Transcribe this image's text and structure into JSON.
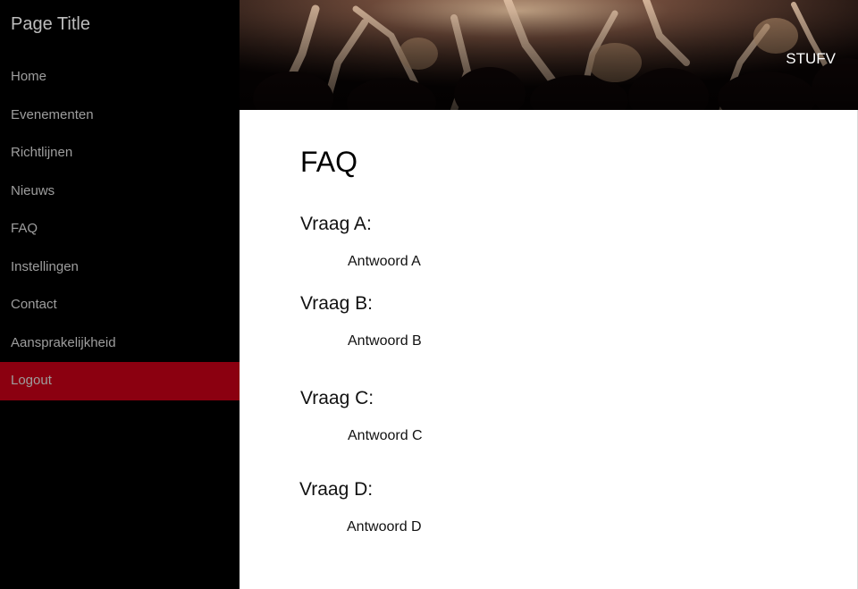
{
  "sidebar": {
    "title": "Page Title",
    "items": [
      {
        "label": "Home"
      },
      {
        "label": "Evenementen"
      },
      {
        "label": "Richtlijnen"
      },
      {
        "label": "Nieuws"
      },
      {
        "label": "FAQ"
      },
      {
        "label": "Instellingen"
      },
      {
        "label": "Contact"
      },
      {
        "label": "Aansprakelijkheid"
      },
      {
        "label": "Logout"
      }
    ],
    "active_item": "Logout",
    "active_color": "#8b0010"
  },
  "header": {
    "brand": "STUFV"
  },
  "main": {
    "heading": "FAQ",
    "faq": [
      {
        "question": "Vraag A:",
        "answer": "Antwoord A"
      },
      {
        "question": "Vraag B:",
        "answer": "Antwoord B"
      },
      {
        "question": "Vraag C:",
        "answer": "Antwoord C"
      },
      {
        "question": "Vraag D:",
        "answer": "Antwoord D"
      }
    ]
  }
}
